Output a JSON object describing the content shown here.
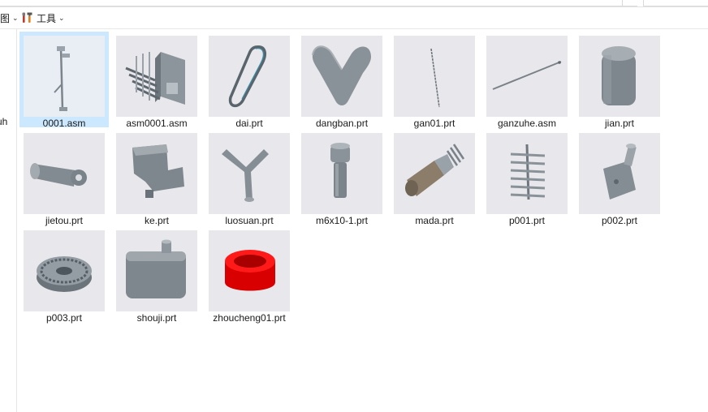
{
  "toolbar": {
    "view_label": "图",
    "tools_label": "工具"
  },
  "nav": {
    "fragment": "uh"
  },
  "files": [
    {
      "name": "0001.asm",
      "icon": "assembly-rod-icon",
      "selected": true
    },
    {
      "name": "asm0001.asm",
      "icon": "assembly-bracket-icon",
      "selected": false
    },
    {
      "name": "dai.prt",
      "icon": "belt-loop-icon",
      "selected": false
    },
    {
      "name": "dangban.prt",
      "icon": "v-plate-icon",
      "selected": false
    },
    {
      "name": "gan01.prt",
      "icon": "thin-rod-icon",
      "selected": false
    },
    {
      "name": "ganzuhe.asm",
      "icon": "long-rod-icon",
      "selected": false
    },
    {
      "name": "jian.prt",
      "icon": "cylinder-icon",
      "selected": false
    },
    {
      "name": "jietou.prt",
      "icon": "joint-icon",
      "selected": false
    },
    {
      "name": "ke.prt",
      "icon": "housing-block-icon",
      "selected": false
    },
    {
      "name": "luosuan.prt",
      "icon": "y-fork-icon",
      "selected": false
    },
    {
      "name": "m6x10-1.prt",
      "icon": "bolt-icon",
      "selected": false
    },
    {
      "name": "mada.prt",
      "icon": "motor-icon",
      "selected": false
    },
    {
      "name": "p001.prt",
      "icon": "comb-part-icon",
      "selected": false
    },
    {
      "name": "p002.prt",
      "icon": "shaft-block-icon",
      "selected": false
    },
    {
      "name": "p003.prt",
      "icon": "pulley-icon",
      "selected": false
    },
    {
      "name": "shouji.prt",
      "icon": "box-tank-icon",
      "selected": false
    },
    {
      "name": "zhoucheng01.prt",
      "icon": "red-ring-icon",
      "selected": false
    }
  ],
  "colors": {
    "selection": "#cce8ff",
    "thumb_bg": "#e8e8ec",
    "part_gray": "#8a9096",
    "ring_red": "#ee0000"
  }
}
